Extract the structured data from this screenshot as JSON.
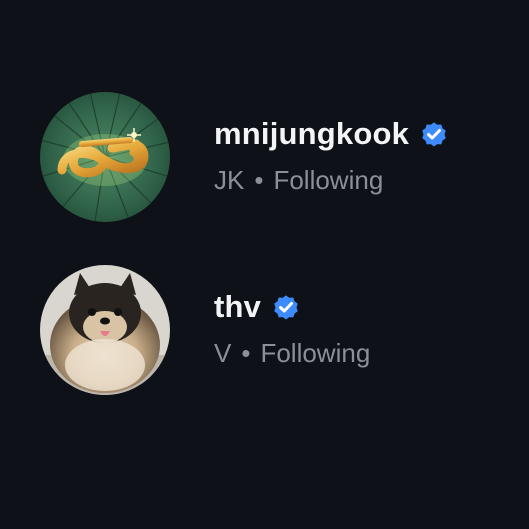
{
  "accounts": [
    {
      "username": "mnijungkook",
      "display_name": "JK",
      "separator": "•",
      "status": "Following",
      "verified": true,
      "avatar_icon": "golden-z-emblem-avatar"
    },
    {
      "username": "thv",
      "display_name": "V",
      "separator": "•",
      "status": "Following",
      "verified": true,
      "avatar_icon": "pomeranian-dog-photo-avatar"
    }
  ],
  "colors": {
    "background": "#0e1117",
    "username": "#f3f4f6",
    "secondary_text": "#8a8f99",
    "verified_badge": "#3d8bfd"
  }
}
